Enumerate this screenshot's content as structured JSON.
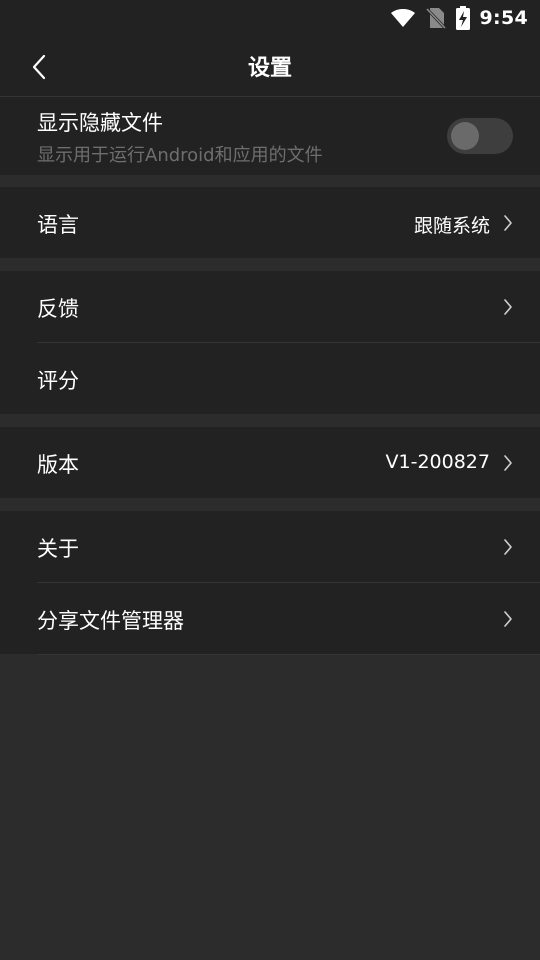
{
  "status_bar": {
    "time": "9:54",
    "icons": [
      "wifi-icon",
      "no-sim-icon",
      "battery-charging-icon"
    ]
  },
  "app_bar": {
    "title": "设置",
    "back_icon": "chevron-left-icon"
  },
  "settings": {
    "show_hidden": {
      "label": "显示隐藏文件",
      "description": "显示用于运行Android和应用的文件",
      "enabled": false
    },
    "language": {
      "label": "语言",
      "value": "跟随系统"
    },
    "feedback": {
      "label": "反馈"
    },
    "rating": {
      "label": "评分"
    },
    "version": {
      "label": "版本",
      "value": "V1-200827"
    },
    "about": {
      "label": "关于"
    },
    "share": {
      "label": "分享文件管理器"
    }
  },
  "colors": {
    "background": "#2c2c2c",
    "surface": "#222222",
    "text_primary": "#ffffff",
    "text_secondary": "#6e6e6e",
    "toggle_track": "#3e3e3e",
    "toggle_thumb": "#6a6a6a"
  }
}
